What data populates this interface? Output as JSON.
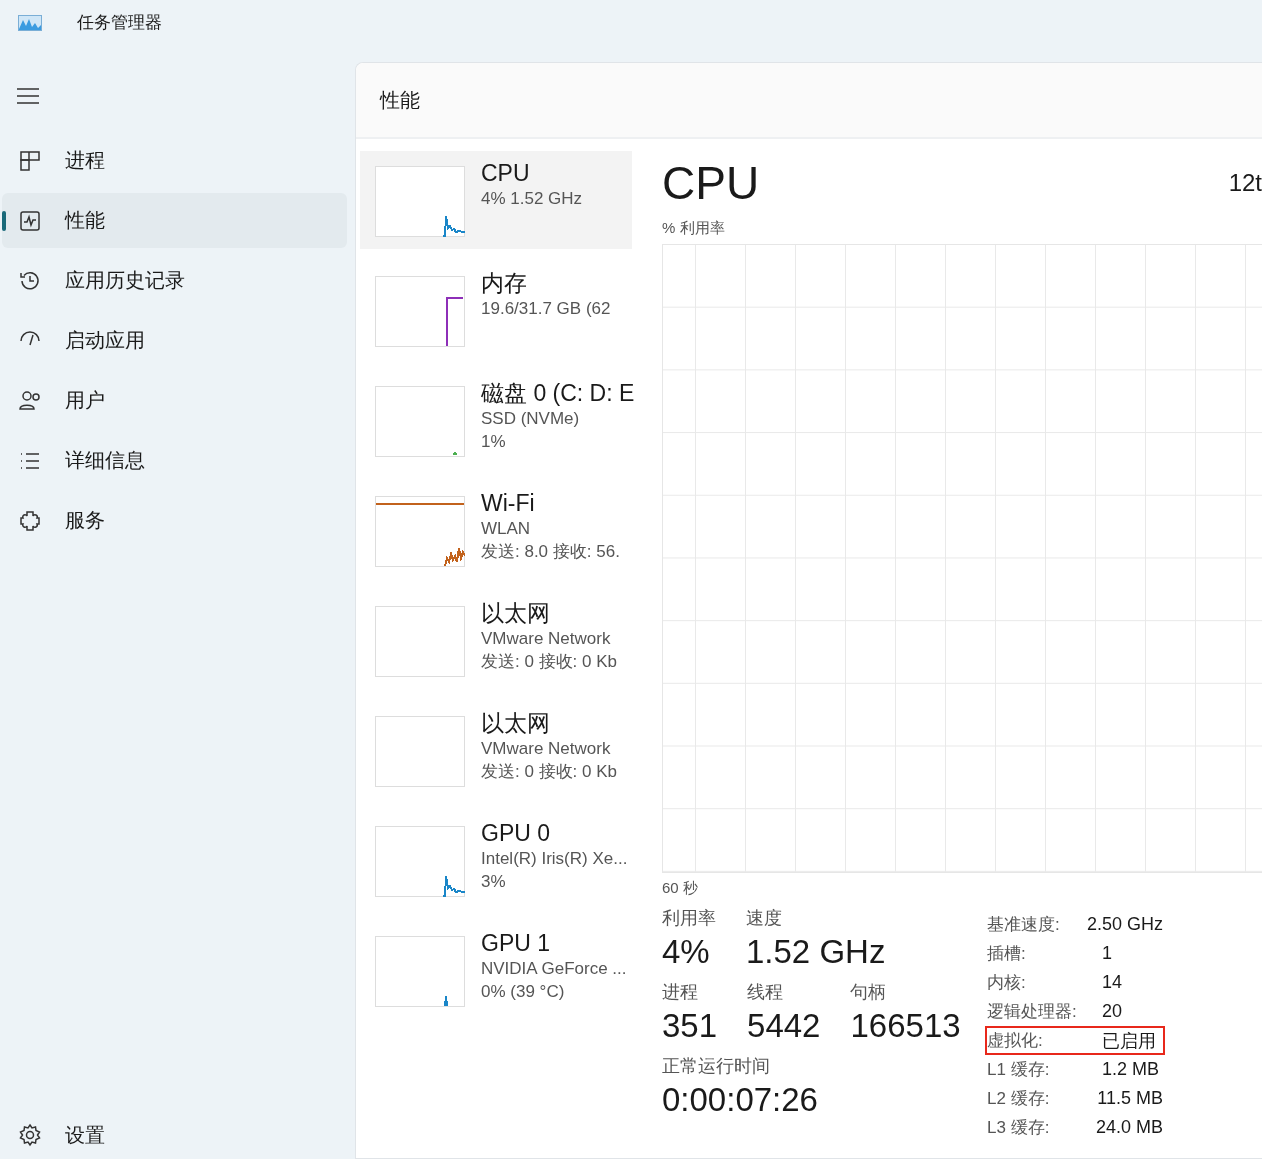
{
  "window": {
    "title": "任务管理器"
  },
  "sidebar": {
    "items": [
      {
        "label": "进程",
        "selected": false
      },
      {
        "label": "性能",
        "selected": true
      },
      {
        "label": "应用历史记录",
        "selected": false
      },
      {
        "label": "启动应用",
        "selected": false
      },
      {
        "label": "用户",
        "selected": false
      },
      {
        "label": "详细信息",
        "selected": false
      },
      {
        "label": "服务",
        "selected": false
      }
    ],
    "settings": "设置"
  },
  "page": {
    "title": "性能"
  },
  "devices": [
    {
      "name": "CPU",
      "lines": [
        "4%  1.52 GHz"
      ],
      "selected": true,
      "kind": "spike",
      "color": "#1a86c8"
    },
    {
      "name": "内存",
      "lines": [
        "19.6/31.7 GB (62"
      ],
      "selected": false,
      "kind": "fill",
      "color": "#8e2fb8"
    },
    {
      "name": "磁盘 0 (C: D: E",
      "lines": [
        "SSD (NVMe)",
        "1%"
      ],
      "selected": false,
      "kind": "flat",
      "color": "#4caf50"
    },
    {
      "name": "Wi-Fi",
      "lines": [
        "WLAN",
        "发送: 8.0 接收: 56."
      ],
      "selected": false,
      "kind": "wave",
      "color": "#c2621c"
    },
    {
      "name": "以太网",
      "lines": [
        "VMware Network",
        "发送: 0 接收: 0 Kb"
      ],
      "selected": false
    },
    {
      "name": "以太网",
      "lines": [
        "VMware Network",
        "发送: 0 接收: 0 Kb"
      ],
      "selected": false
    },
    {
      "name": "GPU 0",
      "lines": [
        "Intel(R) Iris(R) Xe...",
        "3%"
      ],
      "selected": false,
      "kind": "spike",
      "color": "#1a86c8"
    },
    {
      "name": "GPU 1",
      "lines": [
        "NVIDIA GeForce ...",
        "0%  (39 °C)"
      ],
      "selected": false,
      "kind": "tick",
      "color": "#1a86c8"
    }
  ],
  "detail": {
    "title": "CPU",
    "model": "12t",
    "chart_label": "% 利用率",
    "time_label": "60 秒",
    "stats": [
      [
        {
          "label": "利用率",
          "value": "4%"
        },
        {
          "label": "速度",
          "value": "1.52 GHz"
        }
      ],
      [
        {
          "label": "进程",
          "value": "351"
        },
        {
          "label": "线程",
          "value": "5442"
        },
        {
          "label": "句柄",
          "value": "166513"
        }
      ],
      [
        {
          "label": "正常运行时间",
          "value": "0:00:07:26"
        }
      ]
    ],
    "specs": [
      {
        "label": "基准速度:",
        "value": "2.50 GHz",
        "highlighted": false
      },
      {
        "label": "插槽:",
        "value": "1",
        "highlighted": false
      },
      {
        "label": "内核:",
        "value": "14",
        "highlighted": false
      },
      {
        "label": "逻辑处理器:",
        "value": "20",
        "highlighted": false
      },
      {
        "label": "虚拟化:",
        "value": "已启用",
        "highlighted": true
      },
      {
        "label": "L1 缓存:",
        "value": "1.2 MB",
        "highlighted": false
      },
      {
        "label": "L2 缓存:",
        "value": "11.5 MB",
        "highlighted": false
      },
      {
        "label": "L3 缓存:",
        "value": "24.0 MB",
        "highlighted": false
      }
    ]
  }
}
